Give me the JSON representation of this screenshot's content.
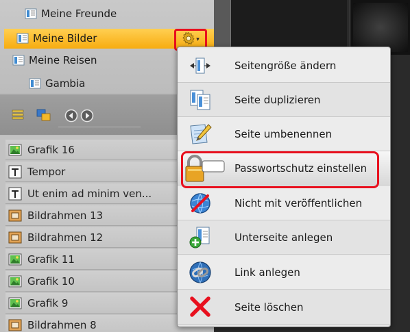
{
  "page_tree": {
    "items": [
      {
        "label": "Meine Freunde"
      },
      {
        "label": "Meine Bilder",
        "selected": true
      },
      {
        "label": "Meine Reisen"
      },
      {
        "label": "Gambia"
      }
    ],
    "selected_color": "#f9b21b"
  },
  "gear_menu": {
    "icon": "gear-icon",
    "caret": "▾"
  },
  "toolbar": {
    "icons": [
      "list-icon",
      "layers-icon",
      "prev-icon",
      "next-icon"
    ]
  },
  "element_list": {
    "rows": [
      {
        "label": "Grafik 16",
        "icon": "image-icon"
      },
      {
        "label": "Tempor",
        "icon": "text-icon"
      },
      {
        "label": "Ut enim ad minim ven...",
        "icon": "text-icon"
      },
      {
        "label": "Bildrahmen 13",
        "icon": "frame-icon"
      },
      {
        "label": "Bildrahmen 12",
        "icon": "frame-icon"
      },
      {
        "label": "Grafik 11",
        "icon": "image-icon"
      },
      {
        "label": "Grafik 10",
        "icon": "image-icon"
      },
      {
        "label": "Grafik 9",
        "icon": "image-icon"
      },
      {
        "label": "Bildrahmen 8",
        "icon": "frame-icon"
      }
    ]
  },
  "context_menu": {
    "items": [
      {
        "label": "Seitengröße ändern",
        "icon": "resize-page-icon"
      },
      {
        "label": "Seite duplizieren",
        "icon": "duplicate-page-icon"
      },
      {
        "label": "Seite umbenennen",
        "icon": "rename-page-icon"
      },
      {
        "label": "Passwortschutz einstellen",
        "icon": "lock-icon",
        "highlighted": true
      },
      {
        "label": "Nicht mit veröffentlichen",
        "icon": "no-publish-icon"
      },
      {
        "label": "Unterseite anlegen",
        "icon": "add-subpage-icon"
      },
      {
        "label": "Link anlegen",
        "icon": "link-icon"
      },
      {
        "label": "Seite löschen",
        "icon": "delete-icon"
      }
    ]
  },
  "colors": {
    "highlight_border": "#e8101e",
    "selection": "#f9b21b"
  }
}
